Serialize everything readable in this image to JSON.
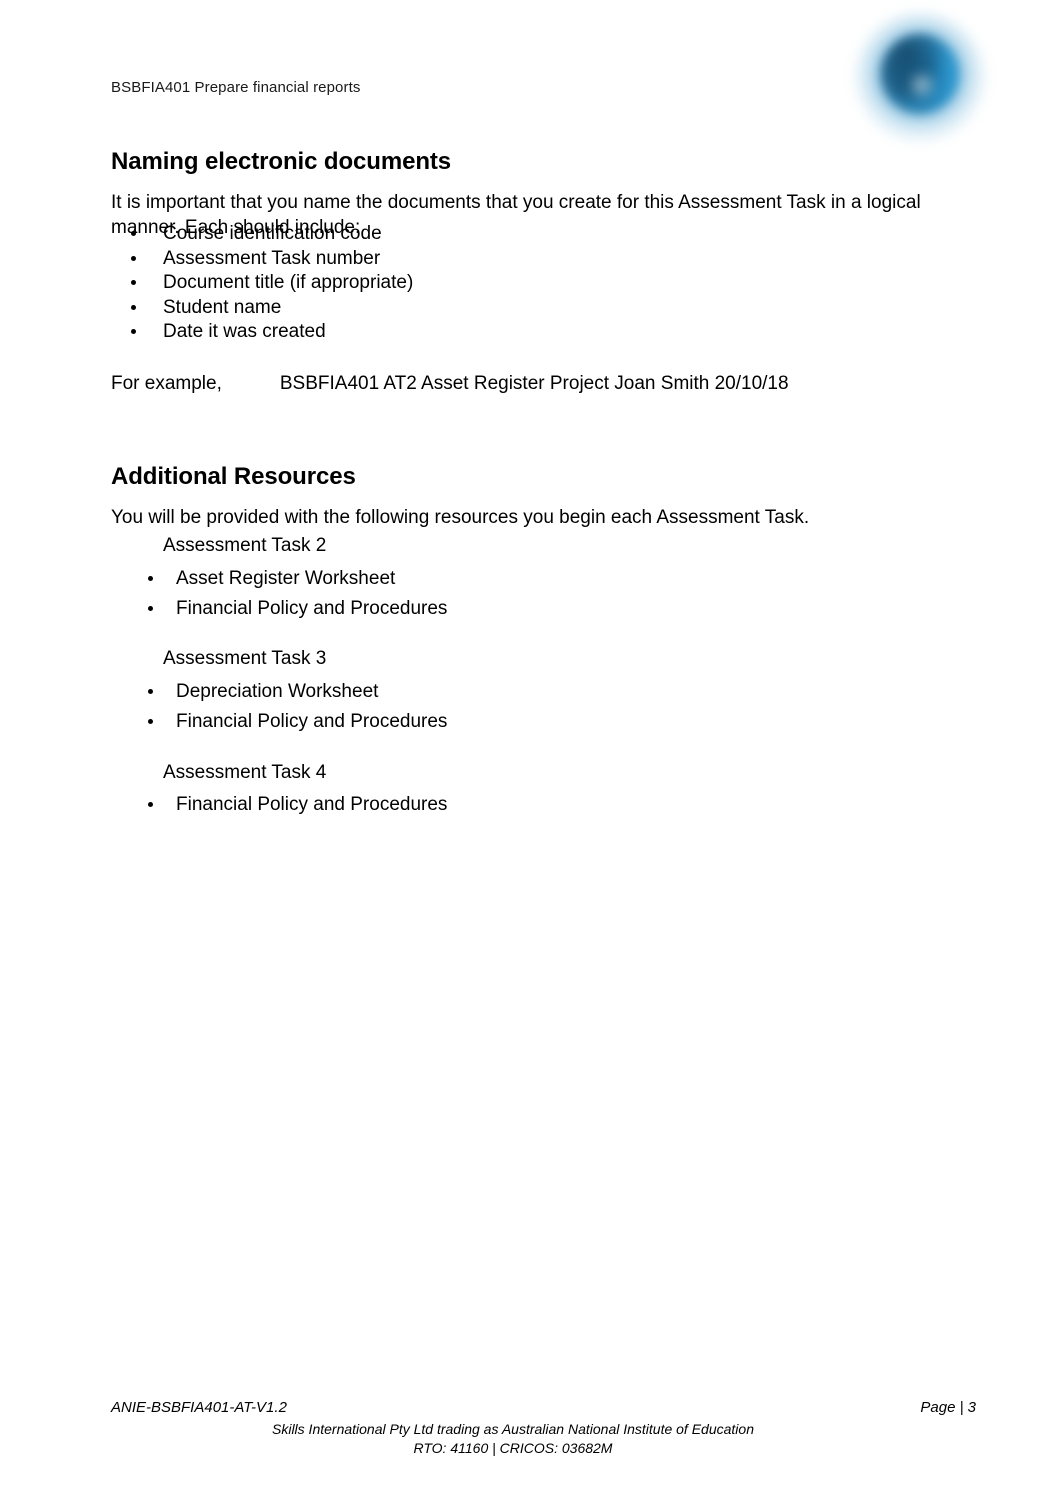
{
  "header": {
    "course_code_title": "BSBFIA401 Prepare financial reports",
    "logo_icon": "globe-icon",
    "logo_color": "#2a8fc4",
    "logo_dark_color": "#1c5a80"
  },
  "sections": {
    "naming": {
      "heading": "Naming electronic documents",
      "intro": "It is important that you name the documents that you create for this Assessment Task in a logical manner. Each should include:",
      "bullets": [
        "Course identification code",
        "Assessment Task number",
        "Document title (if appropriate)",
        "Student name",
        "Date it was created"
      ],
      "example_label": "For example,",
      "example_value": "BSBFIA401 AT2 Asset Register Project Joan Smith 20/10/18"
    },
    "additional_resources": {
      "heading": "Additional Resources",
      "intro": "You will be provided with the following resources you begin each Assessment Task.",
      "tasks": [
        {
          "title": "Assessment Task 2",
          "items": [
            "Asset Register Worksheet",
            "Financial Policy and Procedures"
          ]
        },
        {
          "title": "Assessment Task 3",
          "items": [
            "Depreciation Worksheet",
            "Financial Policy and Procedures"
          ]
        },
        {
          "title": "Assessment Task 4",
          "items": [
            "Financial Policy and Procedures"
          ]
        }
      ]
    }
  },
  "footer": {
    "document_version": "ANIE-BSBFIA401-AT-V1.2",
    "page_label": "Page | 3",
    "organisation": "Skills International Pty Ltd trading as Australian National Institute of Education",
    "registration": "RTO: 41160 | CRICOS: 03682M"
  }
}
